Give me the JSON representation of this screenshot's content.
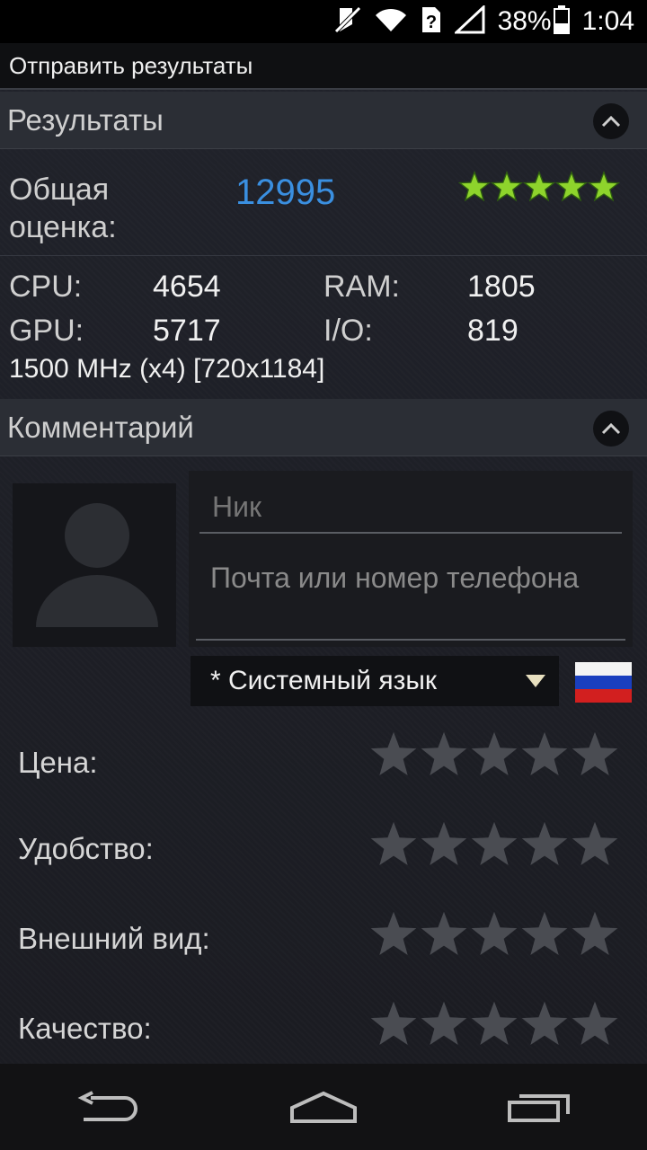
{
  "status_bar": {
    "battery_percent": "38%",
    "time": "1:04",
    "icons": [
      "mute-icon",
      "wifi-icon",
      "no-sim-icon",
      "signal-icon",
      "battery-icon"
    ]
  },
  "title_bar": {
    "title": "Отправить результаты"
  },
  "results": {
    "header": "Результаты",
    "total_label": "Общая оценка:",
    "total_score": "12995",
    "total_stars": 5,
    "metrics": [
      {
        "label": "CPU:",
        "value": "4654"
      },
      {
        "label": "RAM:",
        "value": "1805"
      },
      {
        "label": "GPU:",
        "value": "5717"
      },
      {
        "label": "I/O:",
        "value": "819"
      }
    ],
    "spec": "1500 MHz (x4) [720x1184]"
  },
  "comment": {
    "header": "Комментарий",
    "nick_placeholder": "Ник",
    "contact_placeholder": "Почта или номер телефона",
    "language_selected": "* Системный язык",
    "flag": "russia-flag"
  },
  "ratings": [
    {
      "label": "Цена:",
      "stars": 0
    },
    {
      "label": "Удобство:",
      "stars": 0
    },
    {
      "label": "Внешний вид:",
      "stars": 0
    },
    {
      "label": "Качество:",
      "stars": 0
    }
  ],
  "colors": {
    "accent_blue": "#3a8fe0",
    "star_green": "#8ed42c",
    "star_inactive": "#4a4c52"
  }
}
